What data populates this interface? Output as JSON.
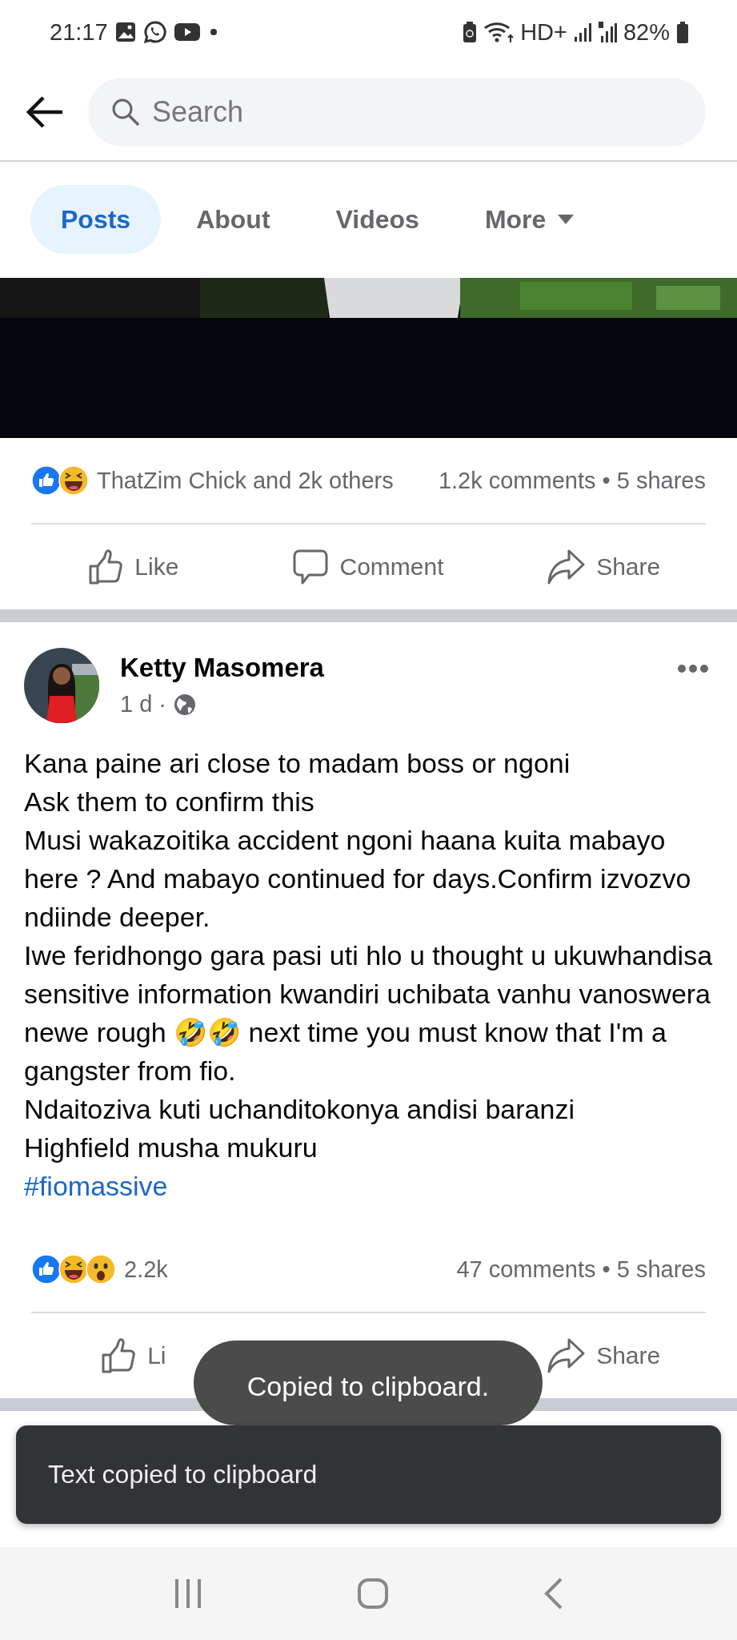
{
  "status_bar": {
    "time": "21:17",
    "network": "HD+",
    "battery": "82%"
  },
  "search": {
    "placeholder": "Search"
  },
  "tabs": [
    {
      "label": "Posts",
      "selected": true,
      "kind": "tab"
    },
    {
      "label": "About",
      "selected": false,
      "kind": "tab"
    },
    {
      "label": "Videos",
      "selected": false,
      "kind": "tab"
    },
    {
      "label": "More",
      "selected": false,
      "kind": "menu"
    }
  ],
  "posts": [
    {
      "video": {
        "kind": "picture"
      },
      "reactions": [
        {
          "kind": "like"
        },
        {
          "kind": "haha"
        }
      ],
      "reaction_summary": "ThatZim Chick and 2k others",
      "comments_shares": "1.2k comments • 5 shares",
      "actions": [
        {
          "kind": "like",
          "label": "Like"
        },
        {
          "kind": "comment",
          "label": "Comment"
        },
        {
          "kind": "share",
          "label": "Share"
        }
      ]
    },
    {
      "author": "Ketty Masomera",
      "time": "1 d ·",
      "text": "Kana paine ari close to madam boss or ngoni\nAsk them to confirm this\nMusi wakazoitika accident ngoni haana kuita mabayo here ? And mabayo continued for days.Confirm izvozvo ndiinde deeper.\nIwe feridhongo gara pasi uti hlo u thought u ukuwhandisa sensitive information kwandiri uchibata vanhu vanoswera newe rough 🤣🤣 next time you must know that I'm a gangster from fio.\nNdaitoziva kuti uchanditokonya andisi baranzi\nHighfield musha mukuru",
      "hashtag": "#fiomassive",
      "reactions": [
        {
          "kind": "like"
        },
        {
          "kind": "haha"
        },
        {
          "kind": "wow"
        }
      ],
      "reaction_summary": "2.2k",
      "comments_shares": "47 comments • 5 shares",
      "actions": [
        {
          "kind": "like",
          "label": "Li"
        },
        {
          "kind": "share",
          "label": "Share"
        }
      ]
    }
  ],
  "toast": "Copied to clipboard.",
  "snackbar": "Text copied to clipboard"
}
